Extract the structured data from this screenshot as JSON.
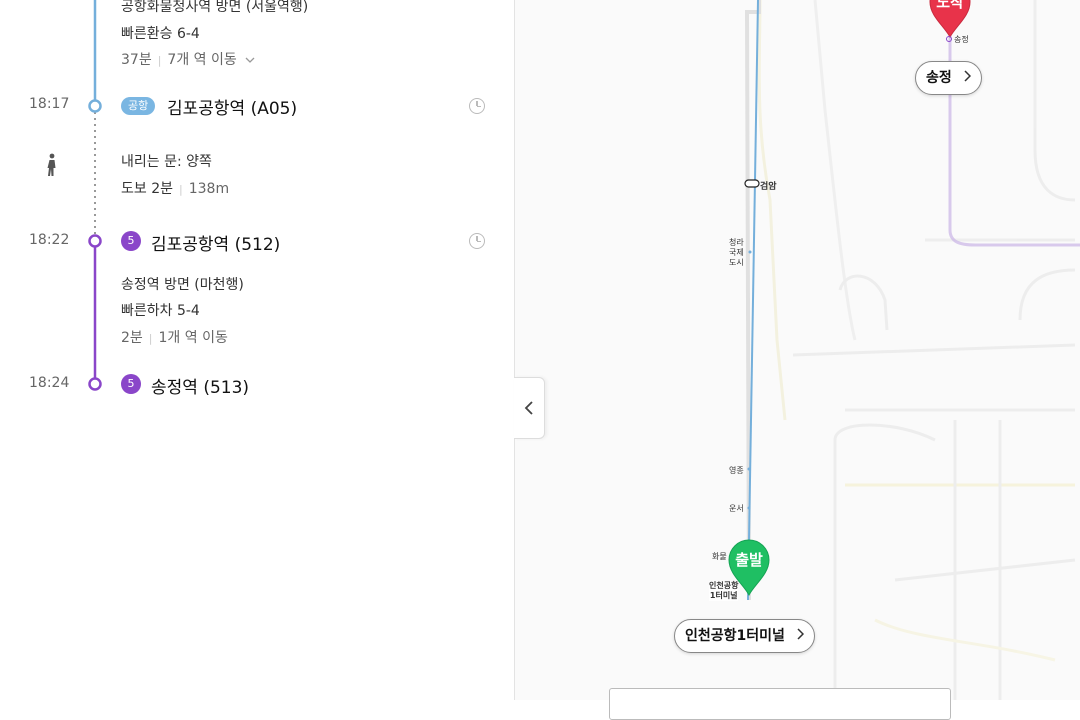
{
  "route": {
    "seg1": {
      "direction": "공항화물청사역 방면 (서울역행)",
      "transfer": "빠른환승 6-4",
      "duration": "37분",
      "stops": "7개 역 이동"
    },
    "stop1": {
      "time": "18:17",
      "badge": "공항",
      "name": "김포공항역 (A05)"
    },
    "walk": {
      "door": "내리는 문: 양쪽",
      "duration": "도보 2분",
      "distance": "138m"
    },
    "stop2": {
      "time": "18:22",
      "badge": "5",
      "name": "김포공항역 (512)"
    },
    "seg2": {
      "direction": "송정역 방면 (마천행)",
      "exit": "빠른하차 5-4",
      "duration": "2분",
      "stops": "1개 역 이동"
    },
    "stop3": {
      "time": "18:24",
      "badge": "5",
      "name": "송정역 (513)"
    }
  },
  "map": {
    "arrival_marker": "도착",
    "arrival_station_small": "송정",
    "arrival_pill": "송정",
    "departure_marker": "출발",
    "departure_station_small": [
      "인천공항",
      "1터미널"
    ],
    "departure_pill": "인천공항1터미널",
    "stations": {
      "geomam": "검암",
      "cheongna": [
        "청라",
        "국제",
        "도시"
      ],
      "yeongjong": "영종",
      "unseo": "운서",
      "hwamul": "화물"
    }
  },
  "colors": {
    "airport_line": "#74afdb",
    "line5": "#8a46c9",
    "departure": "#1fbf63",
    "arrival": "#e8334a"
  }
}
